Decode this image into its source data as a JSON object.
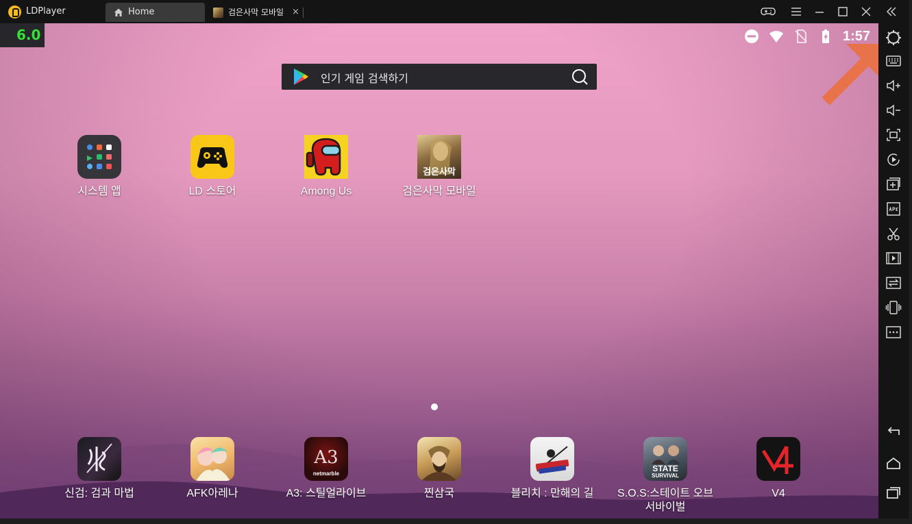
{
  "window": {
    "app_title": "LDPlayer",
    "tabs": [
      {
        "label": "Home",
        "icon": "home-icon"
      },
      {
        "label": "검은사막 모바일",
        "icon": "game-thumbnail-icon"
      }
    ],
    "tab_close": "×"
  },
  "screen": {
    "fps": "6.0",
    "clock": "1:57",
    "search_placeholder": "인기 게임 검색하기",
    "top_apps": [
      {
        "label": "시스템 앱",
        "icon": "system-apps-folder-icon"
      },
      {
        "label": "LD 스토어",
        "icon": "ld-store-icon"
      },
      {
        "label": "Among Us",
        "icon": "among-us-icon"
      },
      {
        "label": "검은사막 모바일",
        "icon": "black-desert-icon"
      }
    ],
    "dock_apps": [
      {
        "label": "신검: 검과 마법",
        "icon": "singeom-icon"
      },
      {
        "label": "AFK아레나",
        "icon": "afk-arena-icon"
      },
      {
        "label": "A3: 스틸얼라이브",
        "icon": "a3-icon"
      },
      {
        "label": "찐삼국",
        "icon": "jjinsamguk-icon"
      },
      {
        "label": "블리치 : 만해의 길",
        "icon": "bleach-icon"
      },
      {
        "label": "S.O.S:스테이트 오브 서바이벌",
        "icon": "state-survival-icon"
      },
      {
        "label": "V4",
        "icon": "v4-icon"
      }
    ],
    "icon_texts": {
      "black_desert": "검은사막",
      "a3": "A3",
      "a3_sub": "netmarble",
      "state_survival": "STATE",
      "state_survival_sub": "SURVIVAL"
    }
  },
  "colors": {
    "accent": "#f5b921",
    "fps_green": "#35e135",
    "arrow": "#e8734a"
  }
}
